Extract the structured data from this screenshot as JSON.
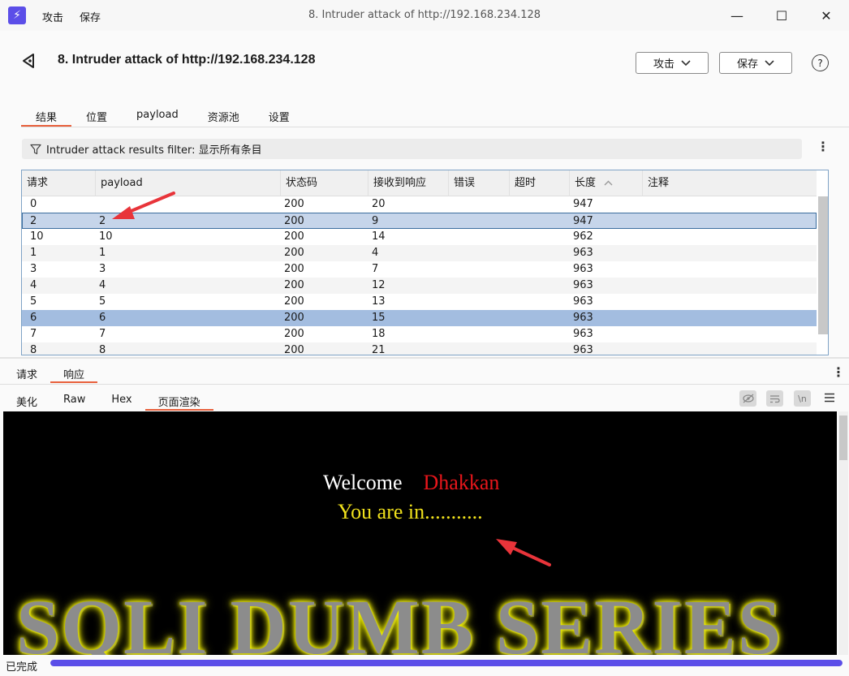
{
  "window": {
    "title": "8. Intruder attack of http://192.168.234.128",
    "menu": [
      "攻击",
      "保存"
    ]
  },
  "header": {
    "title": "8. Intruder attack of http://192.168.234.128",
    "attack_button": "攻击",
    "save_button": "保存",
    "help": "?"
  },
  "tabs": [
    "结果",
    "位置",
    "payload",
    "资源池",
    "设置"
  ],
  "active_tab": "结果",
  "filter": {
    "text": "Intruder attack results filter: 显示所有条目"
  },
  "table": {
    "columns": [
      "请求",
      "payload",
      "状态码",
      "接收到响应",
      "错误",
      "超时",
      "长度",
      "注释"
    ],
    "sort_column": "长度",
    "sort_direction": "ascending",
    "rows": [
      {
        "req": "0",
        "payload": "",
        "status": "200",
        "recv": "20",
        "err": "",
        "timeout": "",
        "len": "947",
        "note": ""
      },
      {
        "req": "2",
        "payload": "2",
        "status": "200",
        "recv": "9",
        "err": "",
        "timeout": "",
        "len": "947",
        "note": ""
      },
      {
        "req": "10",
        "payload": "10",
        "status": "200",
        "recv": "14",
        "err": "",
        "timeout": "",
        "len": "962",
        "note": ""
      },
      {
        "req": "1",
        "payload": "1",
        "status": "200",
        "recv": "4",
        "err": "",
        "timeout": "",
        "len": "963",
        "note": ""
      },
      {
        "req": "3",
        "payload": "3",
        "status": "200",
        "recv": "7",
        "err": "",
        "timeout": "",
        "len": "963",
        "note": ""
      },
      {
        "req": "4",
        "payload": "4",
        "status": "200",
        "recv": "12",
        "err": "",
        "timeout": "",
        "len": "963",
        "note": ""
      },
      {
        "req": "5",
        "payload": "5",
        "status": "200",
        "recv": "13",
        "err": "",
        "timeout": "",
        "len": "963",
        "note": ""
      },
      {
        "req": "6",
        "payload": "6",
        "status": "200",
        "recv": "15",
        "err": "",
        "timeout": "",
        "len": "963",
        "note": ""
      },
      {
        "req": "7",
        "payload": "7",
        "status": "200",
        "recv": "18",
        "err": "",
        "timeout": "",
        "len": "963",
        "note": ""
      },
      {
        "req": "8",
        "payload": "8",
        "status": "200",
        "recv": "21",
        "err": "",
        "timeout": "",
        "len": "963",
        "note": ""
      }
    ]
  },
  "response_tabs": [
    "请求",
    "响应"
  ],
  "active_response_tab": "响应",
  "view_tabs": [
    "美化",
    "Raw",
    "Hex",
    "页面渲染"
  ],
  "active_view_tab": "页面渲染",
  "render": {
    "welcome": "Welcome",
    "name": "Dhakkan",
    "message": "You are in...........",
    "banner": "SQLI DUMB SERIES"
  },
  "status": {
    "text": "已完成",
    "progress": 1.0
  },
  "colors": {
    "accent": "#e8603c",
    "brand": "#5b4ee8",
    "selected_row": "#c6d5ea",
    "highlight_row": "#a3bde0",
    "annotation_arrow": "#e8343a"
  }
}
